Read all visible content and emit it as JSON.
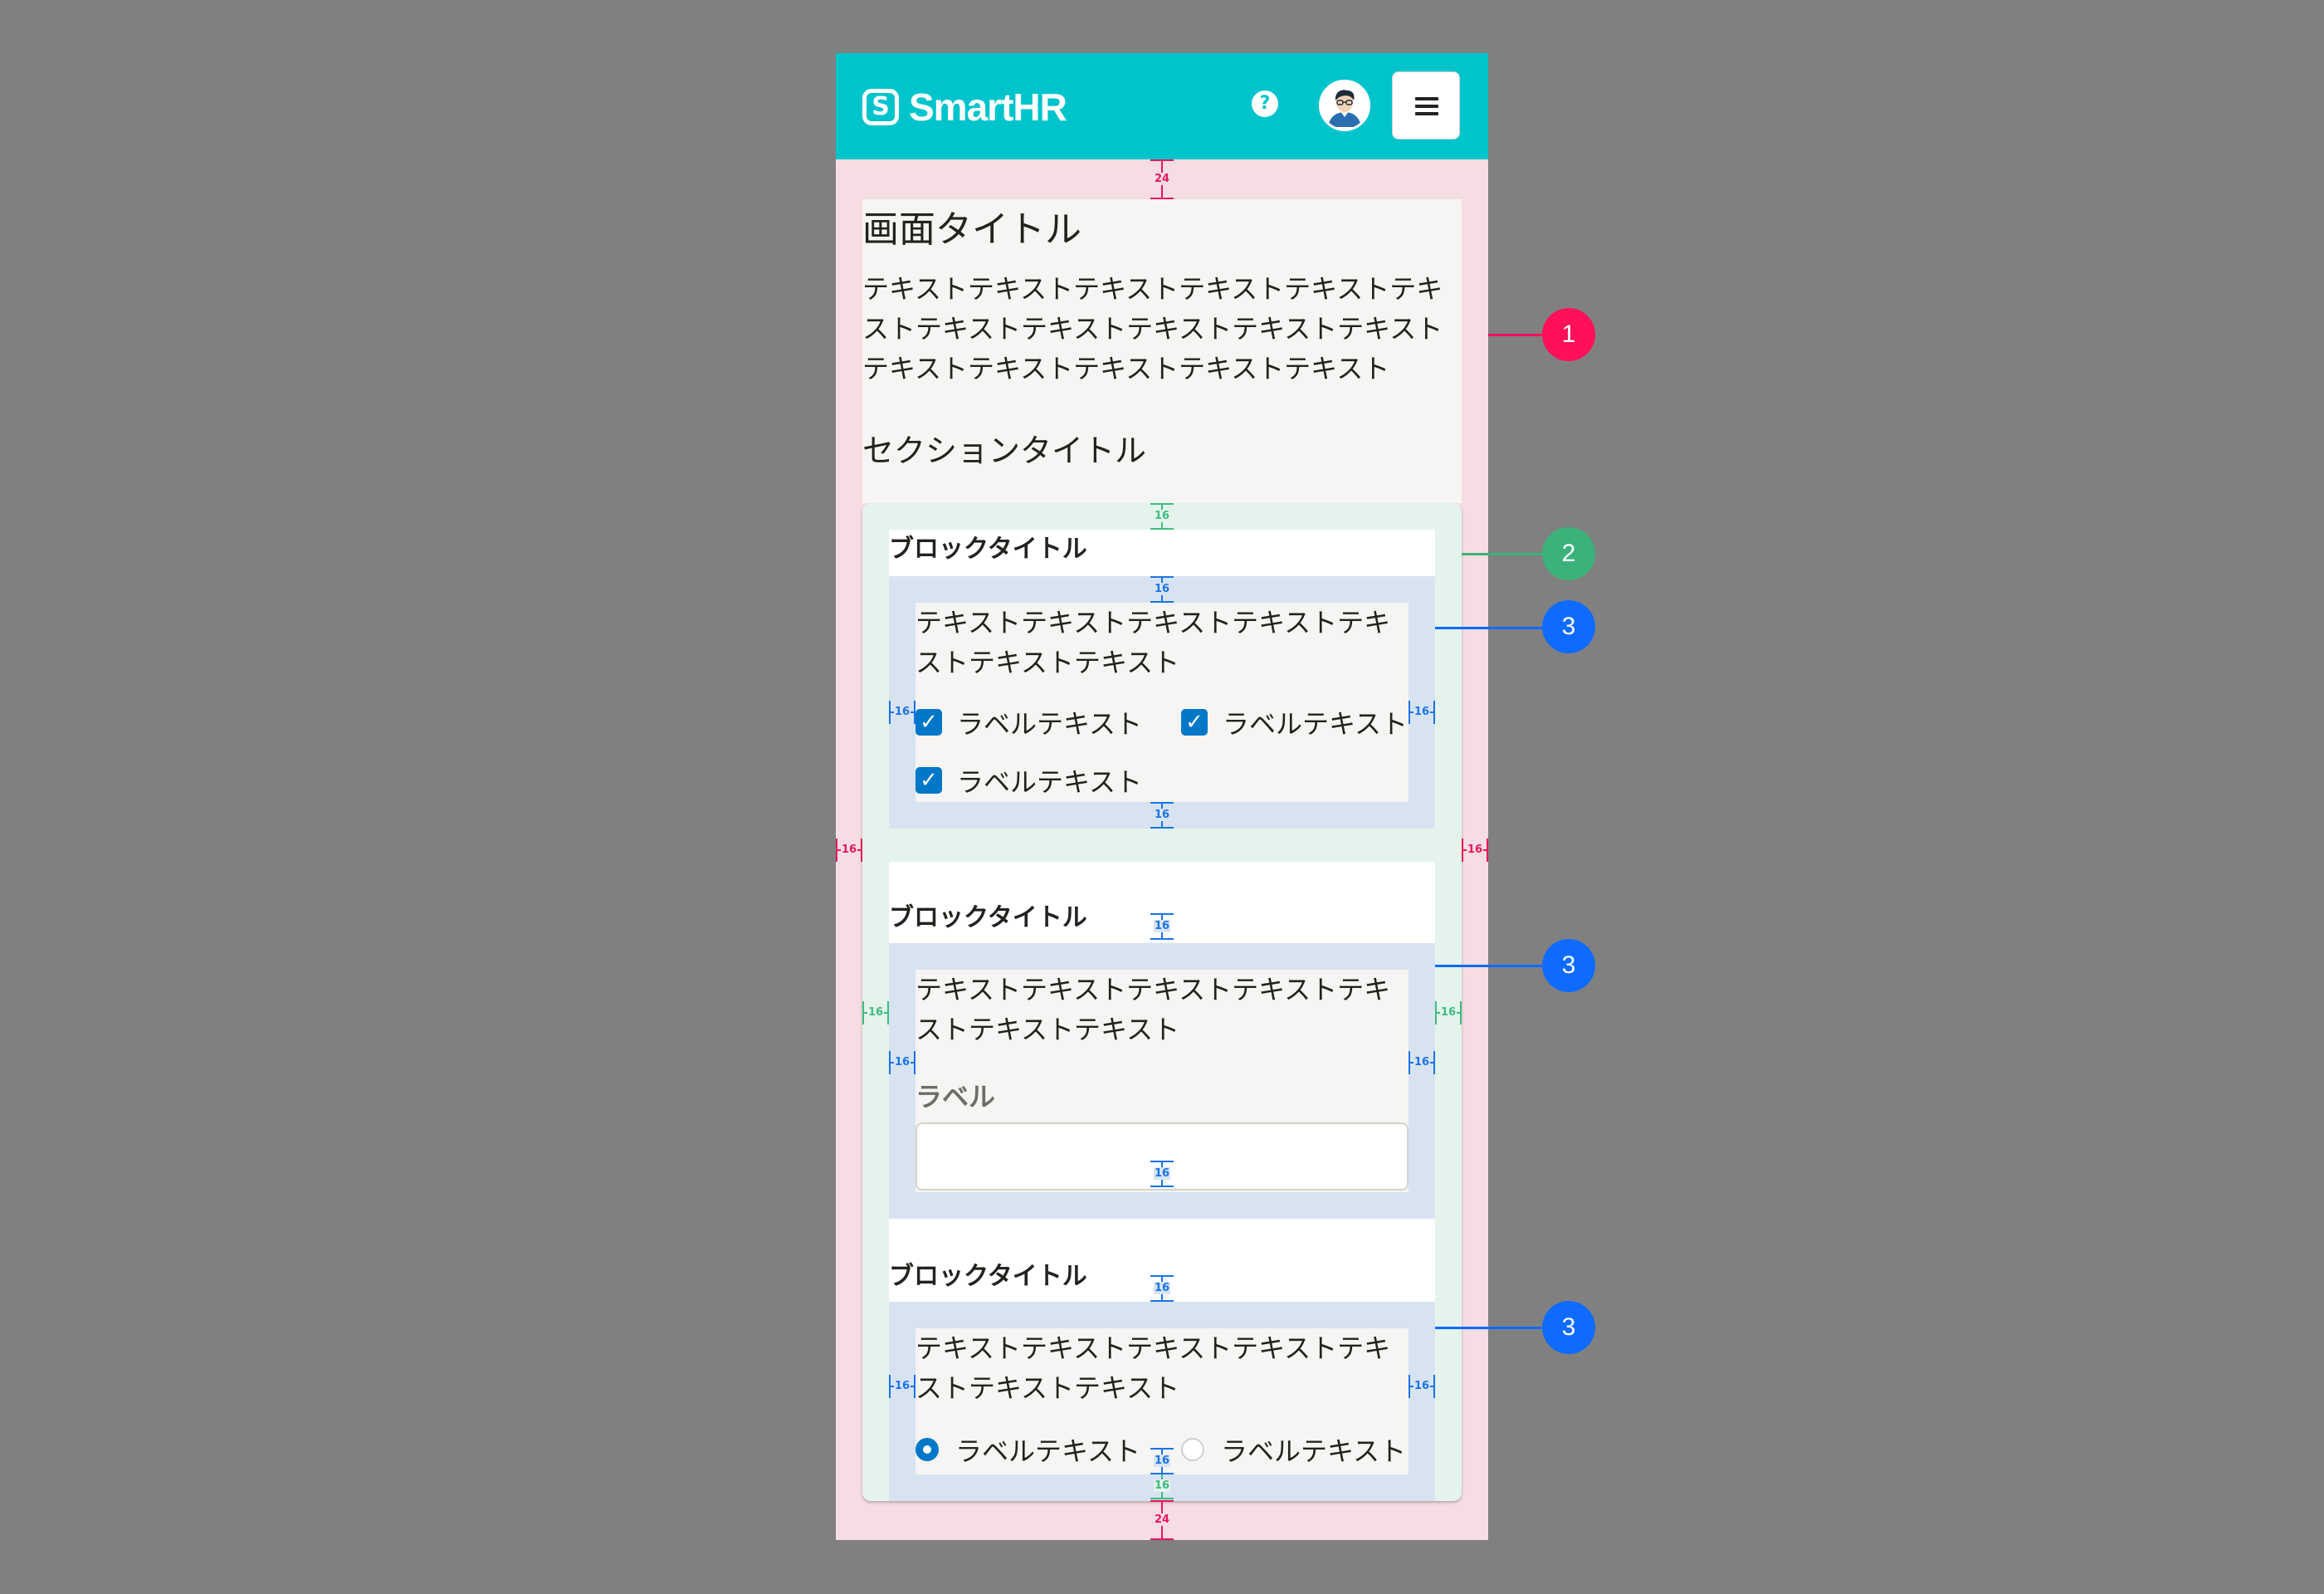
{
  "header": {
    "logo_mark": "S",
    "logo_text": "SmartHR",
    "help_icon": "?",
    "avatar": "avatar-icon",
    "menu_icon": "hamburger-menu-icon"
  },
  "screen": {
    "title": "画面タイトル",
    "intro_text": "テキストテキストテキストテキストテキストテキストテキストテキストテキストテキストテキストテキストテキストテキストテキストテキスト",
    "section_title": "セクションタイトル"
  },
  "blocks": [
    {
      "title": "ブロックタイトル",
      "text": "テキストテキストテキストテキストテキストテキストテキスト",
      "checkboxes": [
        {
          "label": "ラベルテキスト",
          "checked": true
        },
        {
          "label": "ラベルテキスト",
          "checked": true
        },
        {
          "label": "ラベルテキスト",
          "checked": true
        }
      ]
    },
    {
      "title": "ブロックタイトル",
      "text": "テキストテキストテキストテキストテキストテキストテキスト",
      "field_label": "ラベル",
      "field_value": ""
    },
    {
      "title": "ブロックタイトル",
      "text": "テキストテキストテキストテキストテキストテキストテキスト",
      "radios": [
        {
          "label": "ラベルテキスト",
          "selected": true
        },
        {
          "label": "ラベルテキスト",
          "selected": false
        }
      ]
    }
  ],
  "spacing_labels": {
    "screen_gap": "24",
    "section_gap": "16",
    "block_gap": "16"
  },
  "callouts": {
    "screen": "1",
    "section": "2",
    "block": "3"
  },
  "colors": {
    "background": "#808080",
    "header": "#00c4cc",
    "screen_area": "#f6dde3",
    "section_area": "#e4f3ec",
    "block_area": "#d8e3f2",
    "screen_marker": "#e8165b",
    "section_marker": "#3dbd7d",
    "block_marker": "#1a73e8",
    "callout_screen": "#ff1059",
    "callout_section": "#3bb27a",
    "callout_block": "#0f6bff",
    "control_accent": "#0077c7"
  }
}
